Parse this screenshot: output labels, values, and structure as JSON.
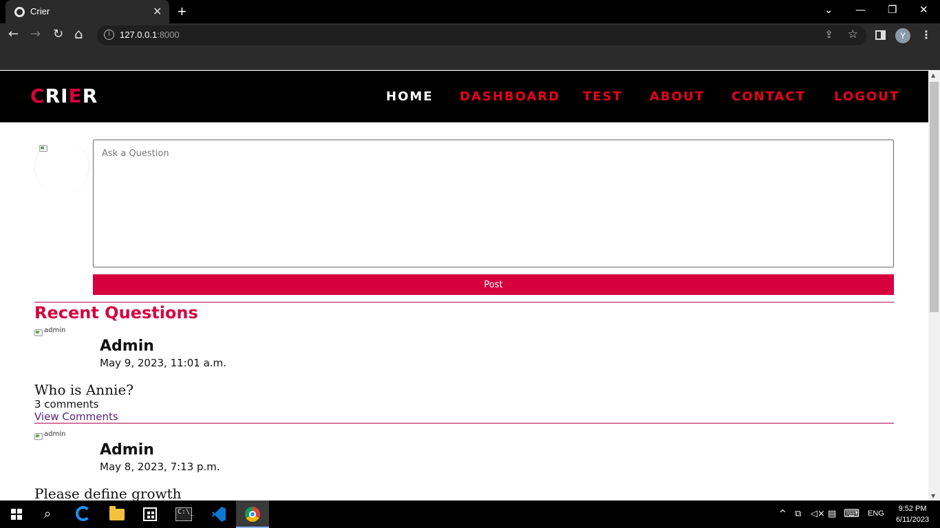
{
  "browser": {
    "tab_title": "Crier",
    "tab_close": "✕",
    "new_tab": "+",
    "url_host": "127.0.0.1",
    "url_port": ":8000",
    "profile_initial": "Y",
    "window_controls": {
      "tab_search": "⌄",
      "minimize": "—",
      "restore": "❐",
      "close": "✕"
    },
    "nav_glyphs": {
      "back": "←",
      "forward": "→",
      "reload": "↻",
      "home": "⌂",
      "info": "i",
      "share": "⇪",
      "star": "☆",
      "menu": "⋮"
    }
  },
  "site": {
    "logo": {
      "c": "C",
      "ri": "RI",
      "e": "E",
      "r": "R"
    },
    "nav": {
      "home": "HOME",
      "dashboard": "DASHBOARD",
      "test": "TEST",
      "about": "ABOUT",
      "contact": "CONTACT",
      "logout": "LOGOUT"
    },
    "accent_color": "#d6003f",
    "nav_link_color": "#e8001a"
  },
  "composer": {
    "placeholder": "Ask a Question",
    "value": "",
    "post_label": "Post"
  },
  "recent": {
    "title": "Recent Questions",
    "questions": [
      {
        "avatar_alt": "admin",
        "author": "Admin",
        "date": "May 9, 2023, 11:01 a.m.",
        "text": "Who is Annie?",
        "comments": "3 comments",
        "link": "View Comments"
      },
      {
        "avatar_alt": "admin",
        "author": "Admin",
        "date": "May 8, 2023, 7:13 p.m.",
        "text": "Please define growth"
      }
    ]
  },
  "taskbar": {
    "apps": [
      "start-icon",
      "search-icon",
      "edge-icon",
      "file-explorer-icon",
      "store-icon",
      "terminal-icon",
      "vscode-icon",
      "chrome-icon"
    ],
    "terminal_label": "C:\\_",
    "search_glyph": "⌕",
    "tray": {
      "chevron": "^",
      "network": "⧉",
      "volume": "◁×",
      "notifications": "▤",
      "keyboard": "⌨",
      "language": "ENG",
      "time": "9:52 PM",
      "date": "6/11/2023"
    }
  }
}
